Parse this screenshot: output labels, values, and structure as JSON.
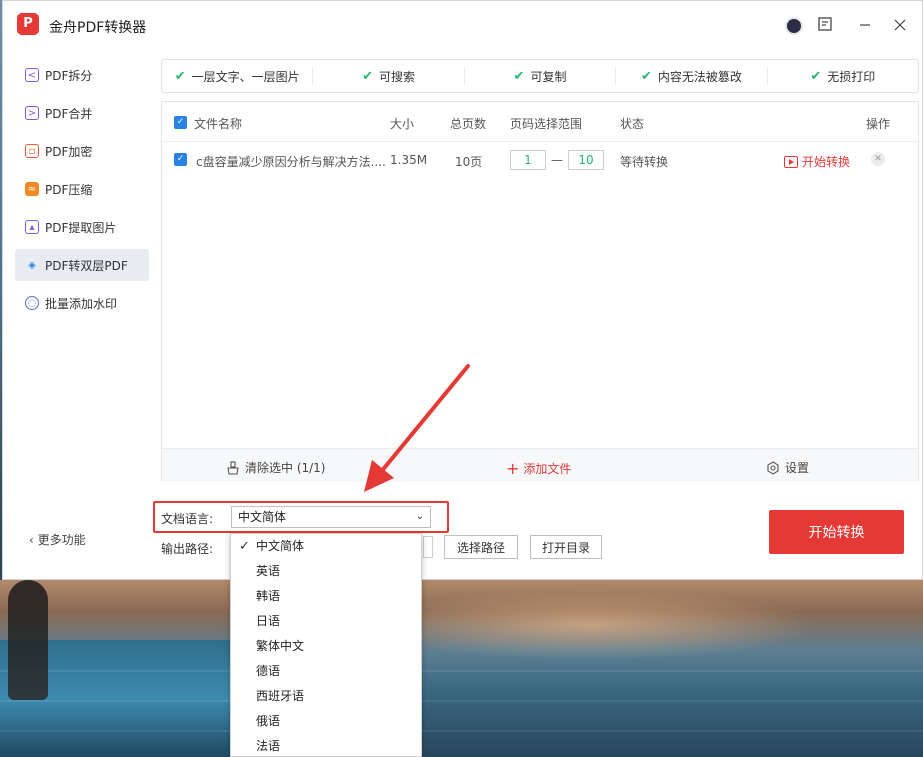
{
  "window": {
    "title": "金舟PDF转换器",
    "logo_text": "P"
  },
  "sidebar": {
    "items": [
      {
        "label": "PDF拆分",
        "icon": "split-icon",
        "color": "#7b5cd6"
      },
      {
        "label": "PDF合并",
        "icon": "merge-icon",
        "color": "#7b5cd6"
      },
      {
        "label": "PDF加密",
        "icon": "lock-icon",
        "color": "#e5603d"
      },
      {
        "label": "PDF压缩",
        "icon": "compress-icon",
        "color": "#f08a24"
      },
      {
        "label": "PDF提取图片",
        "icon": "image-icon",
        "color": "#7b5cd6"
      },
      {
        "label": "PDF转双层PDF",
        "icon": "layers-icon",
        "color": "#2a82e4",
        "active": true
      },
      {
        "label": "批量添加水印",
        "icon": "watermark-icon",
        "color": "#5b6cd6"
      }
    ],
    "more_label": "更多功能"
  },
  "banner": {
    "features": [
      "一层文字、一层图片",
      "可搜索",
      "可复制",
      "内容无法被篡改",
      "无损打印"
    ]
  },
  "table": {
    "headers": {
      "name": "文件名称",
      "size": "大小",
      "pages": "总页数",
      "range": "页码选择范围",
      "status": "状态",
      "action": "操作"
    },
    "rows": [
      {
        "name": "c盘容量减少原因分析与解决方法....",
        "size": "1.35M",
        "pages": "10页",
        "range_start": "1",
        "range_sep": "—",
        "range_end": "10",
        "status": "等待转换",
        "action": "开始转换"
      }
    ],
    "footer": {
      "clear": "清除选中 (1/1)",
      "add": "添加文件",
      "settings": "设置"
    }
  },
  "options": {
    "language_label": "文档语言:",
    "language_value": "中文简体",
    "output_label": "输出路径:",
    "choose_path": "选择路径",
    "open_dir": "打开目录",
    "start": "开始转换"
  },
  "dropdown": {
    "items": [
      "中文简体",
      "英语",
      "韩语",
      "日语",
      "繁体中文",
      "德语",
      "西班牙语",
      "俄语",
      "法语"
    ],
    "selected_index": 0
  },
  "colors": {
    "accent": "#e53935",
    "check": "#2bb673",
    "checkbox": "#2a82e4"
  }
}
